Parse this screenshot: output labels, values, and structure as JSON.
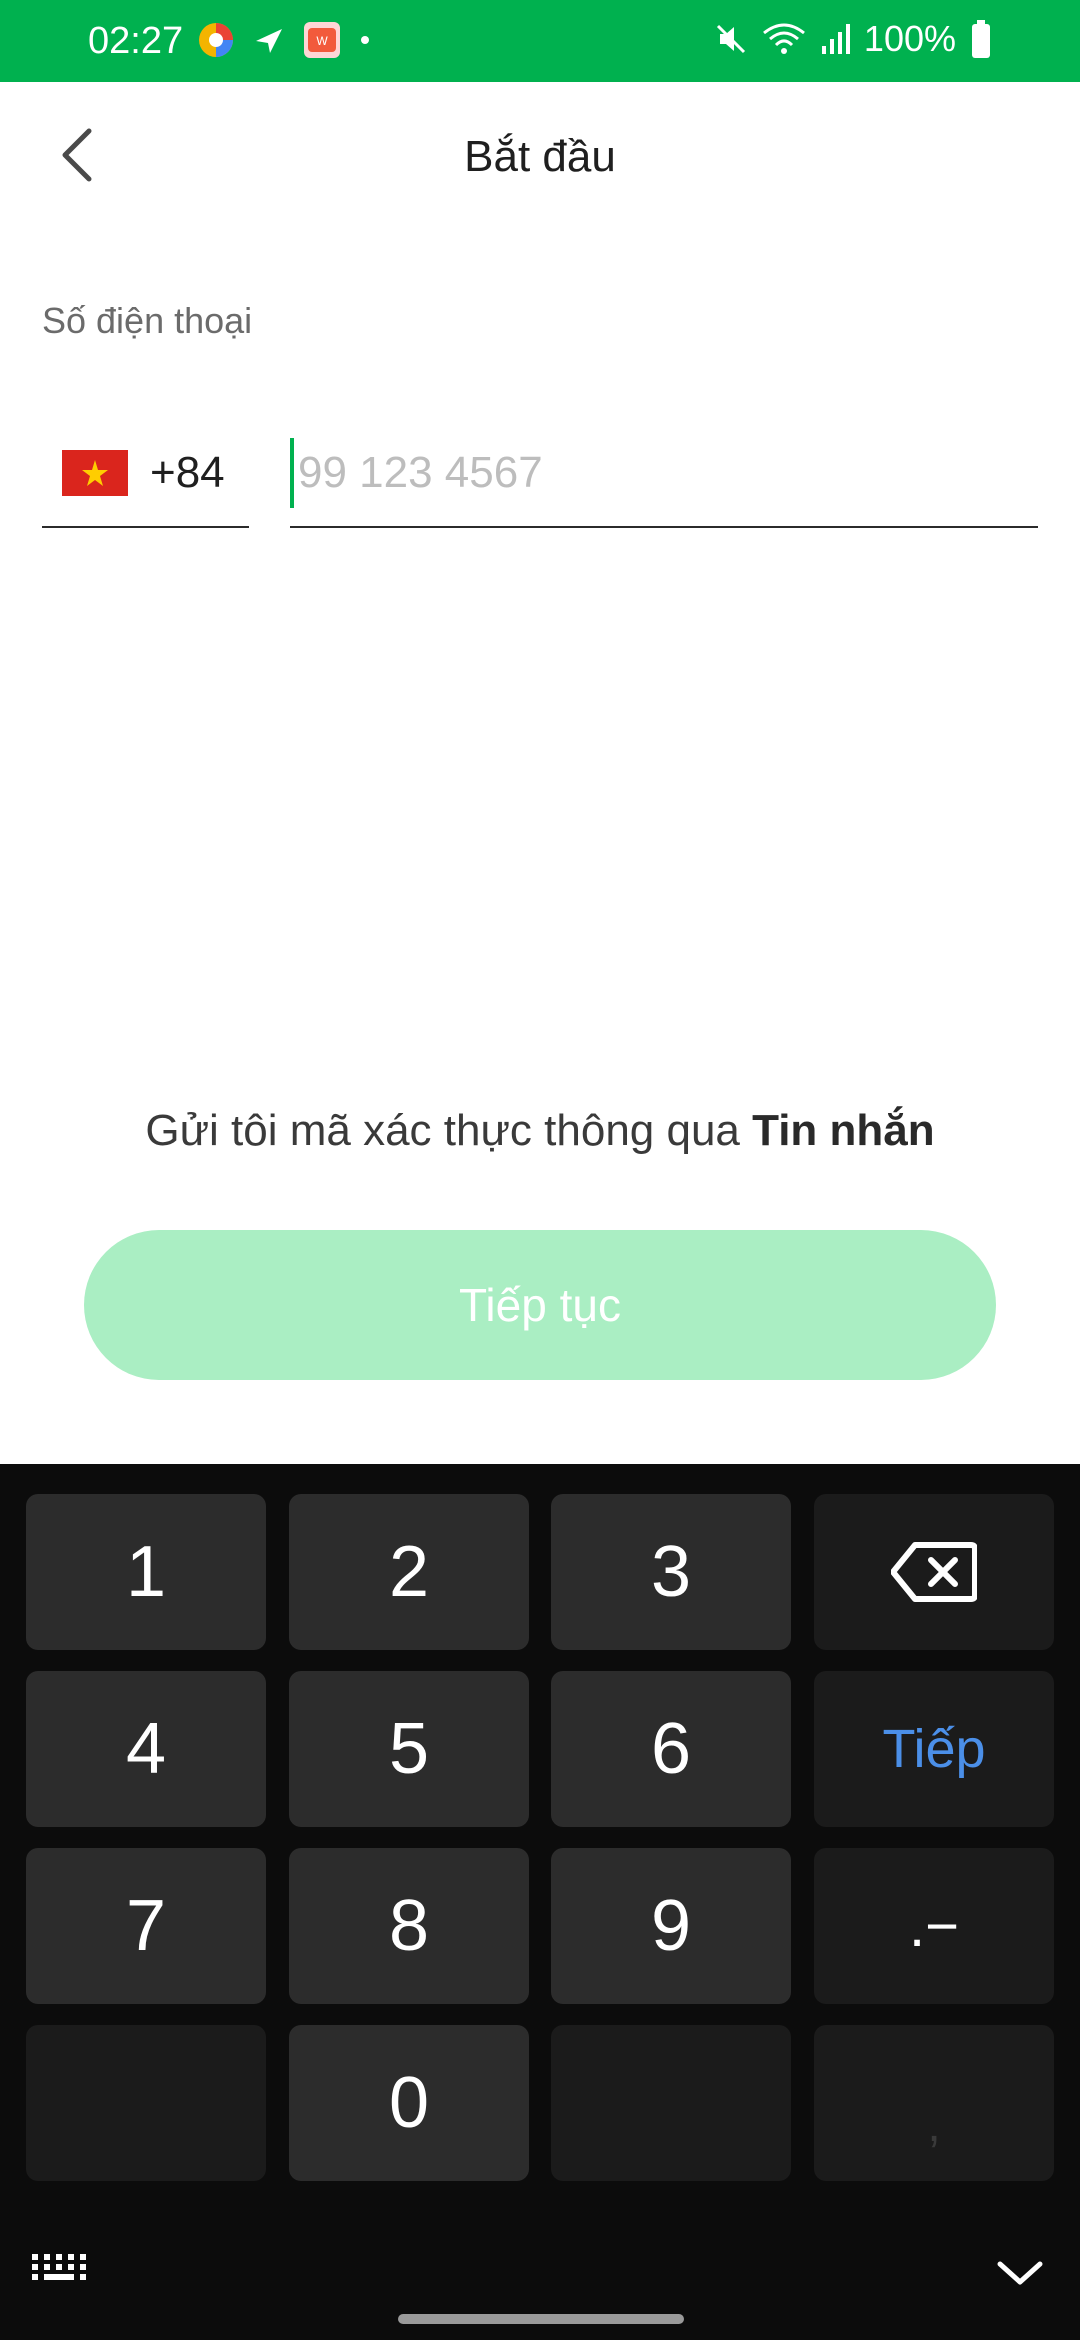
{
  "status_bar": {
    "time": "02:27",
    "battery": "100%",
    "bg_color": "#00b14f"
  },
  "header": {
    "title": "Bắt đầu"
  },
  "form": {
    "phone_label": "Số điện thoại",
    "country_code": "+84",
    "country_flag": "vietnam-flag",
    "phone_placeholder": "99 123 4567",
    "phone_value": ""
  },
  "verification": {
    "prefix": "Gửi tôi mã xác thực thông qua ",
    "method": "Tin nhắn"
  },
  "continue_button": {
    "label": "Tiếp tục",
    "color": "#aaeec3"
  },
  "keyboard": {
    "keys": {
      "k1": "1",
      "k2": "2",
      "k3": "3",
      "k4": "4",
      "k5": "5",
      "k6": "6",
      "k7": "7",
      "k8": "8",
      "k9": "9",
      "k0": "0",
      "next": "Tiếp",
      "symbols": ".−",
      "comma": ","
    },
    "next_color": "#4b8fe8"
  }
}
